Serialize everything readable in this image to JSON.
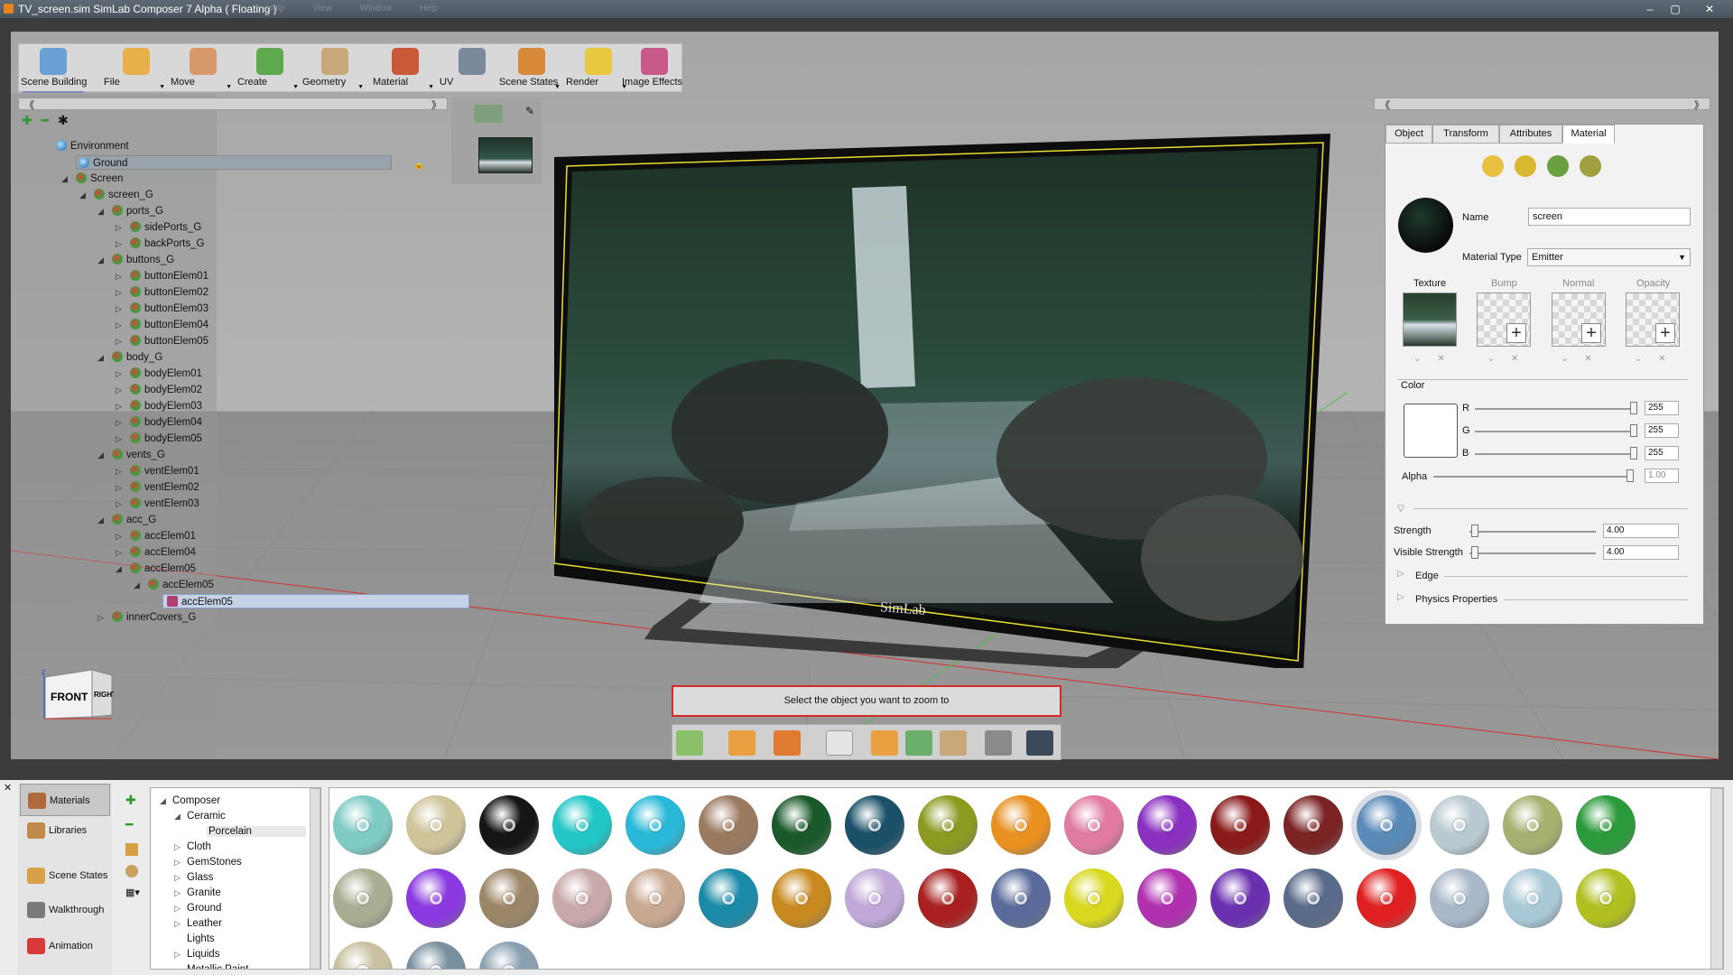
{
  "window": {
    "title": "TV_screen.sim SimLab Composer 7 Alpha ( Floating )",
    "menus": [
      "Help",
      "View",
      "Window",
      "Help"
    ],
    "controls": [
      "–",
      "▢",
      "✕"
    ]
  },
  "toolbar": [
    {
      "label": "Scene Building",
      "color": "#6aa0d4",
      "selected": true,
      "dropdown": false
    },
    {
      "label": "File",
      "color": "#e8b04a",
      "selected": false,
      "dropdown": true
    },
    {
      "label": "Move",
      "color": "#d89a6a",
      "selected": false,
      "dropdown": true
    },
    {
      "label": "Create",
      "color": "#5ea84e",
      "selected": false,
      "dropdown": true
    },
    {
      "label": "Geometry",
      "color": "#c8a878",
      "selected": false,
      "dropdown": true
    },
    {
      "label": "Material",
      "color": "#c85a3a",
      "selected": false,
      "dropdown": true
    },
    {
      "label": "UV",
      "color": "#7a8a9a",
      "selected": false,
      "dropdown": false
    },
    {
      "label": "Scene States",
      "color": "#d88a3a",
      "selected": false,
      "dropdown": true
    },
    {
      "label": "Render",
      "color": "#e8c840",
      "selected": false,
      "dropdown": true
    },
    {
      "label": "Image Effects",
      "color": "#c85a8a",
      "selected": false,
      "dropdown": false
    }
  ],
  "tree": {
    "nodes": [
      {
        "label": "Environment",
        "depth": 0,
        "arrow": ""
      },
      {
        "label": "Ground",
        "depth": 1,
        "arrow": ""
      },
      {
        "label": "Screen",
        "depth": 1,
        "arrow": "◢"
      },
      {
        "label": "screen_G",
        "depth": 2,
        "arrow": "◢"
      },
      {
        "label": "ports_G",
        "depth": 3,
        "arrow": "◢"
      },
      {
        "label": "sidePorts_G",
        "depth": 4,
        "arrow": "▷"
      },
      {
        "label": "backPorts_G",
        "depth": 4,
        "arrow": "▷"
      },
      {
        "label": "buttons_G",
        "depth": 3,
        "arrow": "◢"
      },
      {
        "label": "buttonElem01",
        "depth": 4,
        "arrow": "▷"
      },
      {
        "label": "buttonElem02",
        "depth": 4,
        "arrow": "▷"
      },
      {
        "label": "buttonElem03",
        "depth": 4,
        "arrow": "▷"
      },
      {
        "label": "buttonElem04",
        "depth": 4,
        "arrow": "▷"
      },
      {
        "label": "buttonElem05",
        "depth": 4,
        "arrow": "▷"
      },
      {
        "label": "body_G",
        "depth": 3,
        "arrow": "◢"
      },
      {
        "label": "bodyElem01",
        "depth": 4,
        "arrow": "▷"
      },
      {
        "label": "bodyElem02",
        "depth": 4,
        "arrow": "▷"
      },
      {
        "label": "bodyElem03",
        "depth": 4,
        "arrow": "▷"
      },
      {
        "label": "bodyElem04",
        "depth": 4,
        "arrow": "▷"
      },
      {
        "label": "bodyElem05",
        "depth": 4,
        "arrow": "▷"
      },
      {
        "label": "vents_G",
        "depth": 3,
        "arrow": "◢"
      },
      {
        "label": "ventElem01",
        "depth": 4,
        "arrow": "▷"
      },
      {
        "label": "ventElem02",
        "depth": 4,
        "arrow": "▷"
      },
      {
        "label": "ventElem03",
        "depth": 4,
        "arrow": "▷"
      },
      {
        "label": "acc_G",
        "depth": 3,
        "arrow": "◢"
      },
      {
        "label": "accElem01",
        "depth": 4,
        "arrow": "▷"
      },
      {
        "label": "accElem04",
        "depth": 4,
        "arrow": "▷"
      },
      {
        "label": "accElem05",
        "depth": 4,
        "arrow": "◢"
      },
      {
        "label": "accElem05",
        "depth": 5,
        "arrow": "◢"
      },
      {
        "label": "accElem05",
        "depth": 6,
        "arrow": "",
        "selected": true
      },
      {
        "label": "innerCovers_G",
        "depth": 3,
        "arrow": "▷"
      }
    ]
  },
  "viewport": {
    "status": "Select the object you want to zoom to",
    "cube_front": "FRONT",
    "cube_right": "RIGHT",
    "axis_z": "z",
    "tv_logo": "SimLab"
  },
  "props": {
    "tabs": [
      {
        "label": "Object",
        "active": false
      },
      {
        "label": "Transform",
        "active": false
      },
      {
        "label": "Attributes",
        "active": false
      },
      {
        "label": "Material",
        "active": true
      }
    ],
    "name_label": "Name",
    "name_value": "screen",
    "type_label": "Material Type",
    "type_value": "Emitter",
    "slots": [
      "Texture",
      "Bump",
      "Normal",
      "Opacity"
    ],
    "color_label": "Color",
    "r_label": "R",
    "r_value": "255",
    "g_label": "G",
    "g_value": "255",
    "b_label": "B",
    "b_value": "255",
    "alpha_label": "Alpha",
    "alpha_value": "1.00",
    "strength_label": "Strength",
    "strength_value": "4.00",
    "vstrength_label": "Visible Strength",
    "vstrength_value": "4.00",
    "edge_label": "Edge",
    "physics_label": "Physics Properties"
  },
  "library": {
    "tabs": [
      {
        "label": "Materials",
        "color": "#b06a3a",
        "active": true
      },
      {
        "label": "Libraries",
        "color": "#c08a4a",
        "active": false
      },
      {
        "label": "Scene States",
        "color": "#d8a04a",
        "active": false
      },
      {
        "label": "Walkthrough",
        "color": "#7a7a7a",
        "active": false
      },
      {
        "label": "Animation",
        "color": "#d83a3a",
        "active": false
      }
    ],
    "categories": [
      {
        "label": "Composer",
        "depth": 0,
        "arrow": "◢"
      },
      {
        "label": "Ceramic",
        "depth": 1,
        "arrow": "◢"
      },
      {
        "label": "Porcelain",
        "depth": 2,
        "arrow": "",
        "selected": true
      },
      {
        "label": "Cloth",
        "depth": 1,
        "arrow": "▷"
      },
      {
        "label": "GemStones",
        "depth": 1,
        "arrow": "▷"
      },
      {
        "label": "Glass",
        "depth": 1,
        "arrow": "▷"
      },
      {
        "label": "Granite",
        "depth": 1,
        "arrow": "▷"
      },
      {
        "label": "Ground",
        "depth": 1,
        "arrow": "▷"
      },
      {
        "label": "Leather",
        "depth": 1,
        "arrow": "▷"
      },
      {
        "label": "Lights",
        "depth": 1,
        "arrow": ""
      },
      {
        "label": "Liquids",
        "depth": 1,
        "arrow": "▷"
      },
      {
        "label": "Metallic Paint",
        "depth": 1,
        "arrow": ""
      }
    ],
    "swatch_colors": [
      "#7ecac4",
      "#cfc39a",
      "#151515",
      "#22c6c6",
      "#2ab8d8",
      "#9c7a60",
      "#1a5a2a",
      "#1a5068",
      "#8c9a20",
      "#e89020",
      "#e07aa0",
      "#8a30c0",
      "#8a1a1a",
      "#7a2424",
      "#5a8ab8",
      "#b8cad0",
      "#a8b070",
      "#2a9a3a",
      "#a8ae92",
      "#8a3ae0",
      "#9c8668",
      "#c8a8a8",
      "#c8a890",
      "#1a8aa8",
      "#c88a20",
      "#c0a8d8",
      "#a82020",
      "#5a6a9a",
      "#d8d820",
      "#b030b0",
      "#6a30b0",
      "#5a6a8a",
      "#e02020",
      "#a8b8c8",
      "#a8c8d8",
      "#b0c020",
      "#c8c0a0",
      "#7890a0",
      "#8aa0b0"
    ]
  }
}
